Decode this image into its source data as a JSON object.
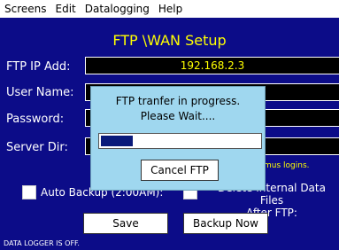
{
  "menu": {
    "items": [
      "Screens",
      "Edit",
      "Datalogging",
      "Help"
    ]
  },
  "screen": {
    "title": "FTP \\WAN Setup",
    "fields": {
      "ftp_ip": {
        "label": "FTP IP Add:",
        "value": "192.168.2.3"
      },
      "user_name": {
        "label": "User Name:",
        "value": ""
      },
      "password": {
        "label": "Password:",
        "value": ""
      },
      "server_dir": {
        "label": "Server Dir:",
        "value": ""
      }
    },
    "note": "mus logins.",
    "auto_backup_label": "Auto Backup (2:00AM):",
    "delete_label_line1": "Delete Internal Data Files",
    "delete_label_line2": "After FTP:",
    "save_label": "Save",
    "backup_now_label": "Backup Now",
    "status_text": "DATA LOGGER IS OFF."
  },
  "dialog": {
    "message_line1": "FTP tranfer in progress.",
    "message_line2": "Please Wait....",
    "progress": 0.2,
    "cancel_label": "Cancel FTP"
  },
  "colors": {
    "background": "#0c0c88",
    "title": "#ffff00",
    "dialog": "#9fd7ef",
    "progress_fill": "#0a1a7a"
  }
}
